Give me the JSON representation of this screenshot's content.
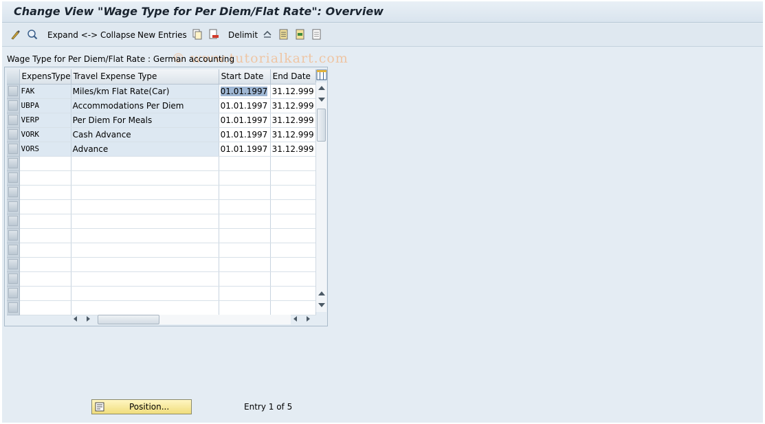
{
  "title": "Change View \"Wage Type for Per Diem/Flat Rate\": Overview",
  "toolbar": {
    "expand_collapse": "Expand <-> Collapse",
    "new_entries": "New Entries",
    "delimit": "Delimit"
  },
  "watermark": "© www.tutorialkart.com",
  "context_label": "Wage Type for Per Diem/Flat Rate : German accounting",
  "table": {
    "columns": [
      "ExpensType",
      "Travel Expense Type",
      "Start Date",
      "End Date"
    ],
    "rows": [
      {
        "type": "FAK",
        "desc": "Miles/km Flat Rate(Car)",
        "start": "01.01.1997",
        "end": "31.12.999"
      },
      {
        "type": "UBPA",
        "desc": "Accommodations Per Diem",
        "start": "01.01.1997",
        "end": "31.12.999"
      },
      {
        "type": "VERP",
        "desc": "Per Diem For Meals",
        "start": "01.01.1997",
        "end": "31.12.999"
      },
      {
        "type": "VORK",
        "desc": "Cash Advance",
        "start": "01.01.1997",
        "end": "31.12.999"
      },
      {
        "type": "VORS",
        "desc": "Advance",
        "start": "01.01.1997",
        "end": "31.12.999"
      }
    ]
  },
  "footer": {
    "position_button": "Position...",
    "entry_info": "Entry 1 of 5"
  },
  "colors": {
    "accent_button": "#f0dd7c",
    "selection_highlight": "#9fb7d4"
  }
}
